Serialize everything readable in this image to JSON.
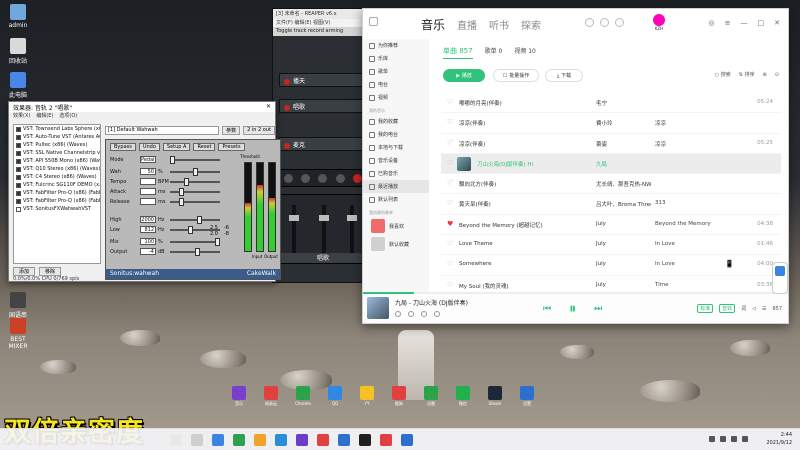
{
  "desktop": {
    "icons": [
      {
        "label": "admin",
        "color": "#6fa8dc"
      },
      {
        "label": "回收站",
        "color": "#d9d9d9"
      },
      {
        "label": "此电脑",
        "color": "#4a86e8"
      },
      {
        "label": "国语串 CPU",
        "color": "#444"
      },
      {
        "label": "BEST MIXER",
        "color": "#cc4125"
      }
    ],
    "subtitle": "双倍亲密度"
  },
  "daw": {
    "title": "[3] 未命名 - REAPER v6.x",
    "menu": "文件(F) 编辑(E) 视图(V)",
    "arm_text": "Toggle track record arming",
    "tracks": [
      "播天",
      "唱歌",
      "麦克",
      "唱歌"
    ],
    "mixer_label": "唱歌",
    "channel_numbers": [
      "1",
      "2"
    ]
  },
  "plugin_window": {
    "title": "效果器: 音轨 2 \"唱歌\"",
    "menu": [
      "效果(X)",
      "编辑(E)",
      "选项(O)"
    ],
    "list": [
      {
        "name": "VST: Townsend Labs Sphere (x6...",
        "checked": true
      },
      {
        "name": "VST: Auto-Tune VST (Antares Au...",
        "checked": true
      },
      {
        "name": "VST: Pultec (x86) (Waves)",
        "checked": true
      },
      {
        "name": "VST: SSL Native Channelstrip v6...",
        "checked": true
      },
      {
        "name": "VST: API 550B Mono (x86) (Wav...",
        "checked": true
      },
      {
        "name": "VST: Q10 Stereo (x86) (Waves)",
        "checked": true
      },
      {
        "name": "VST: C4 Stereo (x86) (Waves)",
        "checked": true
      },
      {
        "name": "VST: Fulcrinc SG110F DEMO (x...",
        "checked": true
      },
      {
        "name": "VST: FabFilter Pro-Q (x86) (FabFilt...",
        "checked": true
      },
      {
        "name": "VST: FabFilter Pro-Q (x86) (FabFilt...",
        "checked": true
      },
      {
        "name": "VST: SonitusFXWahwahVST",
        "checked": false
      }
    ],
    "buttons": [
      "添加",
      "移除"
    ],
    "status": "0.0%/0.0% CPU 0/769 spls",
    "preset": "[1] Default Wahwah",
    "param_label": "参数",
    "io_label": "2 in 2 out",
    "wahwah": {
      "buttons": [
        "Bypass",
        "Undo",
        "Setup A",
        "Reset",
        "Presets"
      ],
      "rows": [
        {
          "label": "Mode",
          "value": "Pedal",
          "unit": "",
          "level": 0.0
        },
        {
          "label": "Wah",
          "value": "50",
          "unit": "%",
          "level": 0.5
        },
        {
          "label": "Tempo",
          "value": "",
          "unit": "BPM",
          "level": 0.3
        },
        {
          "label": "Attack",
          "value": "",
          "unit": "ms",
          "level": 0.2
        },
        {
          "label": "Release",
          "value": "",
          "unit": "ms",
          "level": 0.2
        },
        {
          "label": "High",
          "value": "2000",
          "unit": "Hz",
          "level": 0.6
        },
        {
          "label": "Low",
          "value": "812",
          "unit": "Hz",
          "level": 0.4
        },
        {
          "label": "Mix",
          "value": "100",
          "unit": "%",
          "level": 1.0
        },
        {
          "label": "Output",
          "value": "-4",
          "unit": "dB",
          "level": 0.55
        }
      ],
      "q_values": [
        "2.5",
        "2.0"
      ],
      "db_values": [
        "-6",
        "-8"
      ],
      "meters": [
        "Threshold",
        "Input",
        "Output"
      ],
      "meter_levels": [
        0.55,
        0.75,
        0.6
      ],
      "footer_left": "Sonitus:wahwah",
      "footer_right": "CakeWalk"
    }
  },
  "music": {
    "nav": [
      "音乐",
      "直播",
      "听书",
      "探索"
    ],
    "active_nav": "音乐",
    "user": {
      "name": "KZH"
    },
    "sidebar": {
      "items": [
        "为你推荐",
        "乐库",
        "歌单",
        "电台",
        "视频"
      ],
      "section_mine": "我的音乐",
      "mine_items": [
        "我的收藏",
        "我的电台",
        "本地与下载",
        "音乐设备",
        "已购音乐",
        "最近播放",
        "默认列表"
      ],
      "active": "最近播放",
      "section_pl": "我创建的歌单",
      "playlists": [
        {
          "name": "我喜欢",
          "color": "#f26b6b"
        },
        {
          "name": "默认收藏",
          "color": "#d0d0d0"
        }
      ]
    },
    "tabs": [
      {
        "label": "单曲 857",
        "active": true
      },
      {
        "label": "歌单 0",
        "active": false
      },
      {
        "label": "视频 10",
        "active": false
      }
    ],
    "toolbar": {
      "play_all": "播放",
      "batch": "批量操作",
      "download": "下载",
      "search": "搜索",
      "sort": "排序"
    },
    "songs": [
      {
        "name": "嘟嘟的月亮(伴奏)",
        "artist": "毛宁",
        "album": "",
        "dur": "05:24",
        "liked": false,
        "sel": false
      },
      {
        "name": "凉凉(伴奏)",
        "artist": "費小玲",
        "album": "凉凉",
        "dur": "",
        "liked": false,
        "sel": false
      },
      {
        "name": "凉凉(伴奏)",
        "artist": "萧姿",
        "album": "凉凉",
        "dur": "05:25",
        "liked": false,
        "sel": false
      },
      {
        "name": "刀山火海(DJ版伴奏) Hi",
        "artist": "九局",
        "album": "",
        "dur": "",
        "liked": false,
        "sel": true
      },
      {
        "name": "飘向北方(伴奏)",
        "artist": "尤长靖、那吾克热-NW",
        "album": "",
        "dur": "",
        "liked": false,
        "sel": false
      },
      {
        "name": "黄天旱(伴奏)",
        "artist": "吕大叶、Broma Three",
        "album": "313",
        "dur": "",
        "liked": false,
        "sel": false
      },
      {
        "name": "Beyond the Memory (超越记忆)",
        "artist": "July",
        "album": "Beyond the Memory",
        "dur": "04:38",
        "liked": true,
        "sel": false
      },
      {
        "name": "Love Theme",
        "artist": "July",
        "album": "In Love",
        "dur": "01:46",
        "liked": false,
        "sel": false
      },
      {
        "name": "Somewhere",
        "artist": "July",
        "album": "In Love",
        "dur": "04:00",
        "liked": false,
        "sel": false
      },
      {
        "name": "My Soul (我的灵魂)",
        "artist": "July",
        "album": "Time",
        "dur": "03:36",
        "liked": false,
        "sel": false
      }
    ],
    "player": {
      "title": "九局 - 刀山火海 (DJ版伴奏)",
      "quality": "标准",
      "effect": "音效",
      "count": "857",
      "progress": 0.12
    }
  },
  "taskbar": {
    "time": "2:44",
    "date": "2021/9/12",
    "icons": [
      "#e8e8e8",
      "#cfcfcf",
      "#3b84e0",
      "#2ca24c",
      "#f1a22a",
      "#2b8fd8",
      "#6a3cc9",
      "#e04040",
      "#2d6fd0",
      "#1f1f1f",
      "#e04040",
      "#2d6fd0"
    ]
  },
  "dock_icons": [
    {
      "label": "音乐",
      "color": "#7b3fcf"
    },
    {
      "label": "网易云",
      "color": "#e04040"
    },
    {
      "label": "Chrome",
      "color": "#2aa34a"
    },
    {
      "label": "QQ",
      "color": "#2d88e6"
    },
    {
      "label": "YY",
      "color": "#f6c026"
    },
    {
      "label": "酷狗",
      "color": "#e04040"
    },
    {
      "label": "迅雷",
      "color": "#2aa34a"
    },
    {
      "label": "微信",
      "color": "#21b14c"
    },
    {
      "label": "Steam",
      "color": "#1b2838"
    },
    {
      "label": "设置",
      "color": "#2d6fd0"
    }
  ]
}
